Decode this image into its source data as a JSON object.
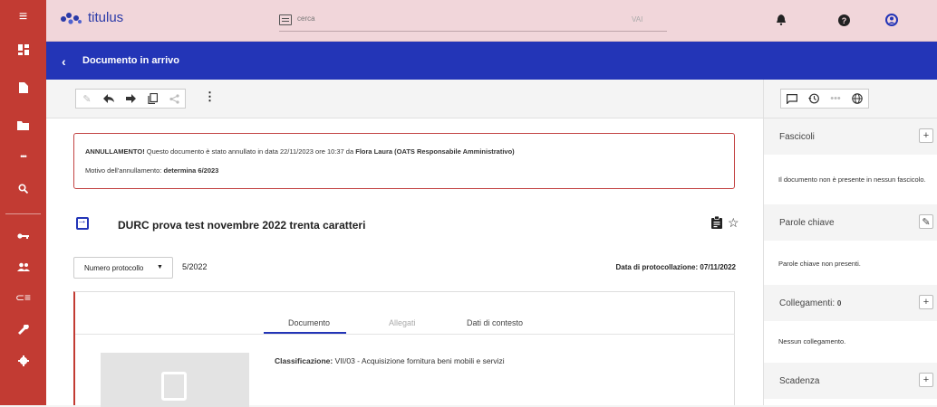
{
  "sidebar": {
    "items": [
      {
        "icon": "hamburger-menu-icon",
        "glyph": "≡"
      },
      {
        "icon": "dashboard-icon",
        "glyph": "▦"
      },
      {
        "icon": "document-icon",
        "glyph": "▪"
      },
      {
        "icon": "folder-icon",
        "glyph": "▬"
      },
      {
        "icon": "more-icon",
        "glyph": "•••"
      },
      {
        "icon": "search-icon",
        "glyph": "⌕"
      },
      {
        "icon": "key-icon",
        "glyph": "⊸"
      },
      {
        "icon": "users-icon",
        "glyph": "👥"
      },
      {
        "icon": "list-icon",
        "glyph": "⊆"
      },
      {
        "icon": "wrench-icon",
        "glyph": "🔧"
      },
      {
        "icon": "gear-icon",
        "glyph": "✸"
      }
    ]
  },
  "topbar": {
    "logo_text": "titulus",
    "search_placeholder": "cerca",
    "search_button": "VAI",
    "icons": [
      "bell-icon",
      "help-icon",
      "user-icon"
    ]
  },
  "header": {
    "title": "Documento in arrivo"
  },
  "alert": {
    "title": "ANNULLAMENTO!",
    "text": " Questo documento è stato annullato in data 22/11/2023 ore 10:37 da ",
    "author": "Flora Laura (OATS Responsabile Amministrativo)",
    "reason_label": "Motivo dell'annullamento: ",
    "reason_value": "determina 6/2023"
  },
  "document": {
    "title": "DURC prova test novembre 2022 trenta caratteri",
    "protocol_select": "Numero protocollo",
    "protocol_number": "5/2022",
    "protocol_date_label": "Data di protocollazione: ",
    "protocol_date": "07/11/2022"
  },
  "tabs": [
    {
      "label": "Documento",
      "active": true,
      "enabled": true
    },
    {
      "label": "Allegati",
      "active": false,
      "enabled": false
    },
    {
      "label": "Dati di contesto",
      "active": false,
      "enabled": true
    }
  ],
  "classification": {
    "label": "Classificazione: ",
    "value": "VII/03 - Acquisizione fornitura beni mobili e servizi"
  },
  "right_panel": {
    "sections": [
      {
        "title": "Fascicoli",
        "action": "+",
        "body": "Il documento non è presente in nessun fascicolo."
      },
      {
        "title": "Parole chiave",
        "action": "✎",
        "body": "Parole chiave non presenti."
      },
      {
        "title": "Collegamenti: ",
        "count": "0",
        "action": "+",
        "body": "Nessun collegamento."
      },
      {
        "title": "Scadenza",
        "action": "+",
        "body": ""
      }
    ]
  },
  "colors": {
    "sidebar": "#c23b33",
    "topbar": "#f1d6da",
    "header": "#2335b7",
    "alert_border": "#c34444"
  }
}
